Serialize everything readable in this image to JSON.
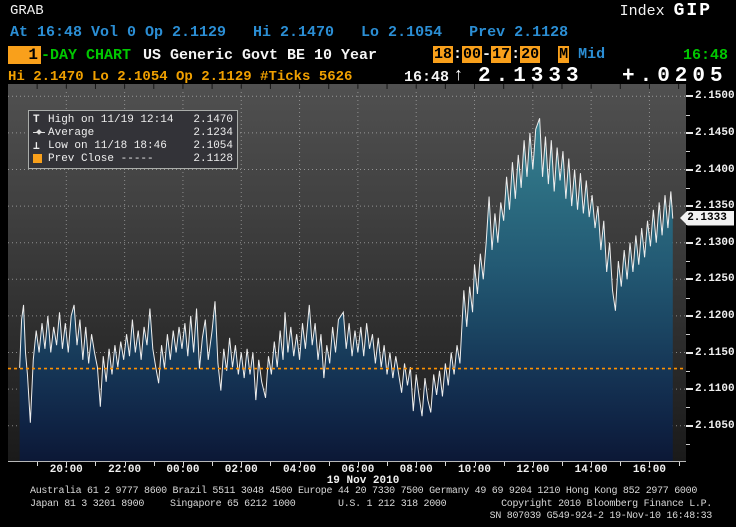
{
  "header": {
    "grab": "GRAB",
    "index_label": "Index",
    "code": "GIP"
  },
  "quote_line": "At 16:48 Vol 0 Op 2.1129   Hi 2.1470   Lo 2.1054   Prev 2.1128",
  "toolbar": {
    "period": "1",
    "period_suffix": "-DAY CHART",
    "security": "US Generic Govt BE 10 Year",
    "session_start_h": "18",
    "session_start_m": "00",
    "session_end_h": "17",
    "session_end_m": "20",
    "colon": ":",
    "dash": "-",
    "m_flag": "M",
    "price_type": "Mid",
    "clock": "16:48"
  },
  "stats_line": {
    "summary": "Hi 2.1470 Lo 2.1054 Op 2.1129 #Ticks 5626",
    "last_time": "16:48",
    "arrow": "↑",
    "last": "2.1333",
    "change": "+.0205"
  },
  "legend": {
    "rows": [
      {
        "icon": "high-marker",
        "label": "High on 11/19 12:14",
        "value": "2.1470"
      },
      {
        "icon": "average-marker",
        "label": "Average",
        "value": "2.1234"
      },
      {
        "icon": "low-marker",
        "label": "Low on 11/18 18:46",
        "value": "2.1054"
      },
      {
        "icon": "prev-close-marker",
        "label": "Prev Close -----",
        "value": "2.1128"
      }
    ],
    "high_glyph": "T",
    "low_glyph": "⊥"
  },
  "price_tag": "2.1333",
  "footer": {
    "line1": "Australia 61 2 9777 8600 Brazil 5511 3048 4500 Europe 44 20 7330 7500 Germany 49 69 9204 1210 Hong Kong 852 2977 6000",
    "line2_japan": "Japan 81 3 3201 8900",
    "line2_singapore": "Singapore 65 6212 1000",
    "line2_us": "U.S. 1 212 318 2000",
    "line2_copyright": "Copyright 2010 Bloomberg Finance L.P.",
    "line3": "SN 807039 G549-924-2 19-Nov-10 16:48:33"
  },
  "colors": {
    "accent_orange": "#f9a01b",
    "text_blue": "#2b8ed4",
    "text_green": "#00c800",
    "text_amber": "#f0a000",
    "prev_close_line": "#ff9200",
    "price_line": "#eeeeee"
  },
  "chart_data": {
    "type": "area",
    "title": "US Generic Govt BE 10 Year — 1-DAY intraday tick chart",
    "x_axis": {
      "start": "18:00 18 Nov 2010",
      "end": "17:20 19 Nov 2010",
      "tick_labels": [
        "20:00",
        "22:00",
        "00:00",
        "02:00",
        "04:00",
        "06:00",
        "08:00",
        "10:00",
        "12:00",
        "14:00",
        "16:00"
      ],
      "date_label": "19 Nov 2010"
    },
    "y_axis": {
      "tick_labels": [
        "2.1500",
        "2.1450",
        "2.1400",
        "2.1350",
        "2.1300",
        "2.1250",
        "2.1200",
        "2.1150",
        "2.1100",
        "2.1050"
      ],
      "minor_ticks": [
        2.1475,
        2.1425,
        2.1375,
        2.1325,
        2.1275,
        2.1225,
        2.1175,
        2.1125,
        2.1075,
        2.1025
      ],
      "min": 2.1,
      "max": 2.1504,
      "grid_step": 0.005
    },
    "grid": true,
    "legend_position": "top-left",
    "stats": {
      "open": 2.1129,
      "high": 2.147,
      "low": 2.1054,
      "last": 2.1333,
      "change": "+.0205",
      "prev_close": 2.1128,
      "average": 2.1234,
      "high_time": "11/19 12:14",
      "low_time": "11/18 18:46",
      "tick_count": 5626,
      "last_time": "16:48"
    },
    "series": [
      {
        "name": "US Generic Govt BE 10 Year (Mid)",
        "x_unit": "minutes after 18:00",
        "points": [
          [
            24,
            2.1129
          ],
          [
            28,
            2.1195
          ],
          [
            32,
            2.1215
          ],
          [
            36,
            2.115
          ],
          [
            40,
            2.112
          ],
          [
            46,
            2.1054
          ],
          [
            52,
            2.114
          ],
          [
            58,
            2.118
          ],
          [
            64,
            2.115
          ],
          [
            70,
            2.119
          ],
          [
            76,
            2.1155
          ],
          [
            82,
            2.12
          ],
          [
            88,
            2.115
          ],
          [
            94,
            2.1185
          ],
          [
            100,
            2.116
          ],
          [
            106,
            2.1205
          ],
          [
            112,
            2.1155
          ],
          [
            118,
            2.119
          ],
          [
            124,
            2.115
          ],
          [
            130,
            2.12
          ],
          [
            136,
            2.1215
          ],
          [
            142,
            2.116
          ],
          [
            148,
            2.1195
          ],
          [
            154,
            2.114
          ],
          [
            160,
            2.1185
          ],
          [
            166,
            2.1135
          ],
          [
            172,
            2.1175
          ],
          [
            178,
            2.115
          ],
          [
            184,
            2.113
          ],
          [
            190,
            2.1076
          ],
          [
            196,
            2.1145
          ],
          [
            202,
            2.111
          ],
          [
            208,
            2.1155
          ],
          [
            214,
            2.112
          ],
          [
            220,
            2.116
          ],
          [
            226,
            2.113
          ],
          [
            232,
            2.1165
          ],
          [
            238,
            2.114
          ],
          [
            244,
            2.1175
          ],
          [
            250,
            2.1145
          ],
          [
            256,
            2.1195
          ],
          [
            262,
            2.115
          ],
          [
            268,
            2.118
          ],
          [
            274,
            2.114
          ],
          [
            280,
            2.1185
          ],
          [
            286,
            2.116
          ],
          [
            292,
            2.121
          ],
          [
            298,
            2.1155
          ],
          [
            304,
            2.113
          ],
          [
            310,
            2.1108
          ],
          [
            316,
            2.116
          ],
          [
            322,
            2.1128
          ],
          [
            328,
            2.1175
          ],
          [
            334,
            2.114
          ],
          [
            340,
            2.118
          ],
          [
            346,
            2.115
          ],
          [
            352,
            2.1185
          ],
          [
            358,
            2.1155
          ],
          [
            364,
            2.119
          ],
          [
            370,
            2.1145
          ],
          [
            376,
            2.12
          ],
          [
            382,
            2.115
          ],
          [
            388,
            2.121
          ],
          [
            394,
            2.1128
          ],
          [
            400,
            2.117
          ],
          [
            406,
            2.1195
          ],
          [
            412,
            2.114
          ],
          [
            420,
            2.118
          ],
          [
            426,
            2.122
          ],
          [
            432,
            2.1135
          ],
          [
            438,
            2.1098
          ],
          [
            444,
            2.1155
          ],
          [
            450,
            2.1125
          ],
          [
            456,
            2.117
          ],
          [
            462,
            2.113
          ],
          [
            468,
            2.116
          ],
          [
            474,
            2.112
          ],
          [
            480,
            2.115
          ],
          [
            486,
            2.1115
          ],
          [
            492,
            2.1155
          ],
          [
            498,
            2.112
          ],
          [
            504,
            2.115
          ],
          [
            510,
            2.1085
          ],
          [
            516,
            2.114
          ],
          [
            522,
            2.111
          ],
          [
            530,
            2.1088
          ],
          [
            536,
            2.1145
          ],
          [
            542,
            2.112
          ],
          [
            548,
            2.1165
          ],
          [
            554,
            2.113
          ],
          [
            560,
            2.118
          ],
          [
            566,
            2.114
          ],
          [
            570,
            2.1205
          ],
          [
            576,
            2.115
          ],
          [
            582,
            2.1185
          ],
          [
            588,
            2.1145
          ],
          [
            594,
            2.1175
          ],
          [
            600,
            2.114
          ],
          [
            606,
            2.119
          ],
          [
            612,
            2.1155
          ],
          [
            620,
            2.1215
          ],
          [
            626,
            2.116
          ],
          [
            632,
            2.119
          ],
          [
            638,
            2.114
          ],
          [
            644,
            2.1175
          ],
          [
            650,
            2.1115
          ],
          [
            656,
            2.116
          ],
          [
            662,
            2.1135
          ],
          [
            668,
            2.1185
          ],
          [
            674,
            2.115
          ],
          [
            680,
            2.1195
          ],
          [
            690,
            2.1205
          ],
          [
            696,
            2.1155
          ],
          [
            702,
            2.119
          ],
          [
            708,
            2.1145
          ],
          [
            714,
            2.118
          ],
          [
            720,
            2.115
          ],
          [
            726,
            2.1185
          ],
          [
            732,
            2.1145
          ],
          [
            738,
            2.119
          ],
          [
            744,
            2.1155
          ],
          [
            750,
            2.1175
          ],
          [
            756,
            2.1135
          ],
          [
            762,
            2.117
          ],
          [
            768,
            2.113
          ],
          [
            774,
            2.116
          ],
          [
            780,
            2.112
          ],
          [
            786,
            2.115
          ],
          [
            792,
            2.1115
          ],
          [
            798,
            2.1145
          ],
          [
            804,
            2.112
          ],
          [
            810,
            2.1095
          ],
          [
            816,
            2.1135
          ],
          [
            822,
            2.1105
          ],
          [
            828,
            2.113
          ],
          [
            834,
            2.107
          ],
          [
            840,
            2.112
          ],
          [
            846,
            2.109
          ],
          [
            852,
            2.1063
          ],
          [
            858,
            2.1115
          ],
          [
            864,
            2.1085
          ],
          [
            870,
            2.1068
          ],
          [
            876,
            2.112
          ],
          [
            882,
            2.1092
          ],
          [
            888,
            2.1125
          ],
          [
            894,
            2.109
          ],
          [
            900,
            2.1135
          ],
          [
            906,
            2.1105
          ],
          [
            912,
            2.115
          ],
          [
            918,
            2.112
          ],
          [
            924,
            2.116
          ],
          [
            930,
            2.1135
          ],
          [
            938,
            2.1235
          ],
          [
            944,
            2.1185
          ],
          [
            950,
            2.124
          ],
          [
            956,
            2.1205
          ],
          [
            960,
            2.127
          ],
          [
            966,
            2.123
          ],
          [
            972,
            2.1285
          ],
          [
            978,
            2.125
          ],
          [
            984,
            2.13
          ],
          [
            990,
            2.1363
          ],
          [
            996,
            2.129
          ],
          [
            1002,
            2.134
          ],
          [
            1008,
            2.13
          ],
          [
            1014,
            2.1355
          ],
          [
            1020,
            2.133
          ],
          [
            1026,
            2.139
          ],
          [
            1032,
            2.1345
          ],
          [
            1038,
            2.141
          ],
          [
            1044,
            2.136
          ],
          [
            1050,
            2.142
          ],
          [
            1056,
            2.1375
          ],
          [
            1062,
            2.144
          ],
          [
            1068,
            2.139
          ],
          [
            1074,
            2.145
          ],
          [
            1080,
            2.14
          ],
          [
            1086,
            2.1455
          ],
          [
            1094,
            2.147
          ],
          [
            1100,
            2.139
          ],
          [
            1106,
            2.1445
          ],
          [
            1112,
            2.138
          ],
          [
            1118,
            2.144
          ],
          [
            1124,
            2.137
          ],
          [
            1130,
            2.143
          ],
          [
            1136,
            2.1385
          ],
          [
            1142,
            2.1425
          ],
          [
            1148,
            2.136
          ],
          [
            1154,
            2.1415
          ],
          [
            1160,
            2.135
          ],
          [
            1166,
            2.14
          ],
          [
            1172,
            2.1345
          ],
          [
            1178,
            2.1395
          ],
          [
            1184,
            2.134
          ],
          [
            1190,
            2.1385
          ],
          [
            1196,
            2.1335
          ],
          [
            1202,
            2.1365
          ],
          [
            1208,
            2.132
          ],
          [
            1214,
            2.135
          ],
          [
            1220,
            2.129
          ],
          [
            1226,
            2.133
          ],
          [
            1232,
            2.126
          ],
          [
            1238,
            2.13
          ],
          [
            1244,
            2.1235
          ],
          [
            1250,
            2.1207
          ],
          [
            1256,
            2.1275
          ],
          [
            1262,
            2.124
          ],
          [
            1268,
            2.129
          ],
          [
            1274,
            2.125
          ],
          [
            1280,
            2.13
          ],
          [
            1286,
            2.126
          ],
          [
            1292,
            2.131
          ],
          [
            1298,
            2.127
          ],
          [
            1304,
            2.132
          ],
          [
            1310,
            2.128
          ],
          [
            1316,
            2.133
          ],
          [
            1322,
            2.1295
          ],
          [
            1328,
            2.1345
          ],
          [
            1334,
            2.13
          ],
          [
            1340,
            2.1355
          ],
          [
            1346,
            2.131
          ],
          [
            1352,
            2.1365
          ],
          [
            1358,
            2.132
          ],
          [
            1364,
            2.137
          ],
          [
            1368,
            2.1333
          ]
        ]
      }
    ]
  }
}
